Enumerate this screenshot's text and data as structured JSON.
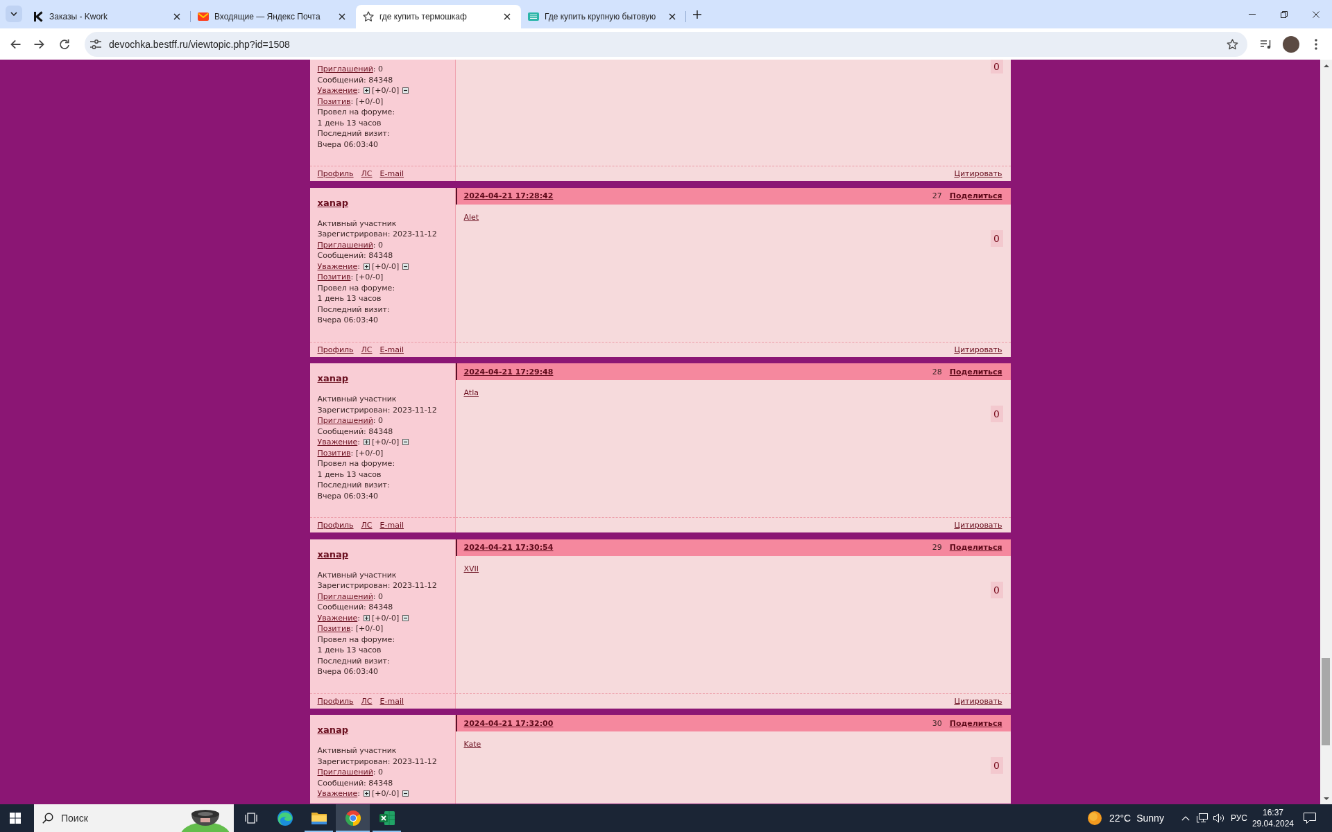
{
  "browser": {
    "tabs": [
      {
        "title": "Заказы - Kwork",
        "selected": false
      },
      {
        "title": "Входящие — Яндекс Почта",
        "selected": false
      },
      {
        "title": "где купить термошкаф",
        "selected": true
      },
      {
        "title": "Где купить крупную бытовую",
        "selected": false
      }
    ],
    "address": "devochka.bestff.ru/viewtopic.php?id=1508"
  },
  "posts": [
    {
      "profile": [
        {
          "kind": "link",
          "label": "Приглашений",
          "value": ": 0"
        },
        {
          "kind": "text",
          "text": "Сообщений: 84348"
        },
        {
          "kind": "rating",
          "label": "Уважение",
          "colon": ":",
          "value": "[+0/-0]"
        },
        {
          "kind": "link",
          "label": "Позитив",
          "value": ": [+0/-0]"
        },
        {
          "kind": "text",
          "text": "Провел на форуме:"
        },
        {
          "kind": "text",
          "text": "1 день 13 часов"
        },
        {
          "kind": "text",
          "text": "Последний визит:"
        },
        {
          "kind": "text",
          "text": "Вчера 06:03:40"
        }
      ],
      "votes": "0",
      "footer_links": [
        "Профиль",
        "ЛС",
        "E-mail"
      ],
      "quote": "Цитировать"
    },
    {
      "author": "xanap",
      "date": "2024-04-21 17:28:42",
      "number": "27",
      "share": "Поделиться",
      "profile": [
        {
          "kind": "text",
          "text": "Активный участник"
        },
        {
          "kind": "text",
          "text": "Зарегистрирован: 2023-11-12"
        },
        {
          "kind": "link",
          "label": "Приглашений",
          "value": ": 0"
        },
        {
          "kind": "text",
          "text": "Сообщений: 84348"
        },
        {
          "kind": "rating",
          "label": "Уважение",
          "colon": ":",
          "value": "[+0/-0]"
        },
        {
          "kind": "link",
          "label": "Позитив",
          "value": ": [+0/-0]"
        },
        {
          "kind": "text",
          "text": "Провел на форуме:"
        },
        {
          "kind": "text",
          "text": "1 день 13 часов"
        },
        {
          "kind": "text",
          "text": "Последний визит:"
        },
        {
          "kind": "text",
          "text": "Вчера 06:03:40"
        }
      ],
      "message": "Alet",
      "votes": "0",
      "footer_links": [
        "Профиль",
        "ЛС",
        "E-mail"
      ],
      "quote": "Цитировать"
    },
    {
      "author": "xanap",
      "date": "2024-04-21 17:29:48",
      "number": "28",
      "share": "Поделиться",
      "profile": [
        {
          "kind": "text",
          "text": "Активный участник"
        },
        {
          "kind": "text",
          "text": "Зарегистрирован: 2023-11-12"
        },
        {
          "kind": "link",
          "label": "Приглашений",
          "value": ": 0"
        },
        {
          "kind": "text",
          "text": "Сообщений: 84348"
        },
        {
          "kind": "rating",
          "label": "Уважение",
          "colon": ":",
          "value": "[+0/-0]"
        },
        {
          "kind": "link",
          "label": "Позитив",
          "value": ": [+0/-0]"
        },
        {
          "kind": "text",
          "text": "Провел на форуме:"
        },
        {
          "kind": "text",
          "text": "1 день 13 часов"
        },
        {
          "kind": "text",
          "text": "Последний визит:"
        },
        {
          "kind": "text",
          "text": "Вчера 06:03:40"
        }
      ],
      "message": "Atla",
      "votes": "0",
      "footer_links": [
        "Профиль",
        "ЛС",
        "E-mail"
      ],
      "quote": "Цитировать"
    },
    {
      "author": "xanap",
      "date": "2024-04-21 17:30:54",
      "number": "29",
      "share": "Поделиться",
      "profile": [
        {
          "kind": "text",
          "text": "Активный участник"
        },
        {
          "kind": "text",
          "text": "Зарегистрирован: 2023-11-12"
        },
        {
          "kind": "link",
          "label": "Приглашений",
          "value": ": 0"
        },
        {
          "kind": "text",
          "text": "Сообщений: 84348"
        },
        {
          "kind": "rating",
          "label": "Уважение",
          "colon": ":",
          "value": "[+0/-0]"
        },
        {
          "kind": "link",
          "label": "Позитив",
          "value": ": [+0/-0]"
        },
        {
          "kind": "text",
          "text": "Провел на форуме:"
        },
        {
          "kind": "text",
          "text": "1 день 13 часов"
        },
        {
          "kind": "text",
          "text": "Последний визит:"
        },
        {
          "kind": "text",
          "text": "Вчера 06:03:40"
        }
      ],
      "message": "XVII",
      "votes": "0",
      "footer_links": [
        "Профиль",
        "ЛС",
        "E-mail"
      ],
      "quote": "Цитировать"
    },
    {
      "author": "xanap",
      "date": "2024-04-21 17:32:00",
      "number": "30",
      "share": "Поделиться",
      "profile": [
        {
          "kind": "text",
          "text": "Активный участник"
        },
        {
          "kind": "text",
          "text": "Зарегистрирован: 2023-11-12"
        },
        {
          "kind": "link",
          "label": "Приглашений",
          "value": ": 0"
        },
        {
          "kind": "text",
          "text": "Сообщений: 84348"
        },
        {
          "kind": "rating",
          "label": "Уважение",
          "colon": ":",
          "value": "[+0/-0]"
        }
      ],
      "message": "Kate",
      "votes": "0"
    }
  ],
  "taskbar": {
    "search": {
      "placeholder": "Поиск"
    },
    "apps": [
      {
        "running": false,
        "selected": false
      },
      {
        "running": true,
        "selected": false
      },
      {
        "running": true,
        "selected": true
      },
      {
        "running": true,
        "selected": false
      }
    ],
    "weather": {
      "temperature": "22°C",
      "condition": "Sunny"
    },
    "language": "РУС",
    "time": "16:37",
    "date": "29.04.2024"
  }
}
